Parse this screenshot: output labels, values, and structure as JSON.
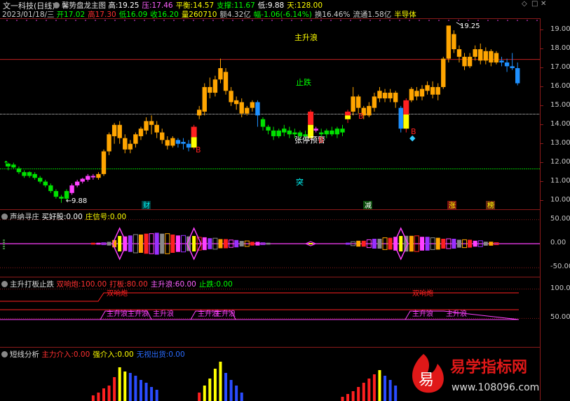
{
  "window": {
    "title": "文一科技(日线)",
    "indicator_name": "馨势盘龙主图",
    "controls": [
      "◇",
      "□",
      "✕"
    ]
  },
  "main_info": {
    "items": [
      {
        "label": "高:",
        "value": "19.25",
        "color": "#ffffff"
      },
      {
        "label": "压:",
        "value": "17.46",
        "color": "#ff60ff"
      },
      {
        "label": "平衡:",
        "value": "14.57",
        "color": "#ffff00"
      },
      {
        "label": "支撑:",
        "value": "11.67",
        "color": "#00ff00"
      },
      {
        "label": "低:",
        "value": "9.88",
        "color": "#ffffff"
      },
      {
        "label": "天:",
        "value": "128.00",
        "color": "#ffff00"
      }
    ]
  },
  "quote_bar": {
    "date": "2023/01/18/三",
    "items": [
      {
        "text": "开17.02",
        "color": "#00ff00"
      },
      {
        "text": "高17.30",
        "color": "#ff3030"
      },
      {
        "text": "低16.09",
        "color": "#00ff00"
      },
      {
        "text": "收16.20",
        "color": "#00ff00"
      },
      {
        "text": "量260710",
        "color": "#ffff00"
      },
      {
        "text": "额4.32亿",
        "color": "#cccccc"
      },
      {
        "text": "幅-1.06(-6.14%)",
        "color": "#00ff00"
      },
      {
        "text": "换16.46%",
        "color": "#cccccc"
      },
      {
        "text": "流通1.58亿",
        "color": "#cccccc"
      },
      {
        "text": "半导体",
        "color": "#ffff00"
      }
    ]
  },
  "main_chart": {
    "ylim": [
      9.5,
      19.6
    ],
    "y_ticks": [
      "19.00",
      "18.00",
      "17.00",
      "16.00",
      "15.00",
      "14.00",
      "13.00",
      "12.00",
      "11.00",
      "10.00"
    ],
    "resistance": 17.46,
    "balance": 14.57,
    "support": 11.67,
    "high_label": "19.25",
    "low_label": "9.88",
    "annotations": {
      "main_wave": "主升浪",
      "stop_fall": "止跌",
      "limit_up_warn": "张停预警",
      "breakout": "突",
      "buy1": "B",
      "buy2": "B",
      "buy3": "B",
      "buy4": "B",
      "arrow_up": "↑",
      "diamond": "◆"
    },
    "bottom_tags": [
      "财",
      "减",
      "涨",
      "榜"
    ]
  },
  "chart_data": {
    "type": "candlestick",
    "ylim": [
      9.5,
      19.6
    ],
    "candles": [
      [
        11.8,
        11.95,
        11.6,
        12.0,
        "g"
      ],
      [
        11.9,
        11.75,
        11.7,
        12.0,
        "g"
      ],
      [
        11.7,
        11.5,
        11.4,
        11.8,
        "g"
      ],
      [
        11.5,
        11.3,
        11.2,
        11.6,
        "g"
      ],
      [
        11.3,
        11.5,
        11.2,
        11.55,
        "g"
      ],
      [
        11.4,
        11.2,
        11.1,
        11.5,
        "g"
      ],
      [
        11.2,
        11.0,
        10.9,
        11.3,
        "g"
      ],
      [
        11.0,
        10.8,
        10.7,
        11.1,
        "g"
      ],
      [
        10.8,
        10.5,
        10.4,
        10.9,
        "g"
      ],
      [
        10.5,
        10.2,
        10.1,
        10.6,
        "g"
      ],
      [
        10.2,
        10.1,
        9.88,
        10.3,
        "g"
      ],
      [
        10.1,
        10.5,
        10.0,
        10.6,
        "g"
      ],
      [
        10.4,
        10.8,
        10.3,
        10.9,
        "m"
      ],
      [
        10.8,
        11.0,
        10.7,
        11.1,
        "m"
      ],
      [
        11.0,
        11.15,
        10.9,
        11.2,
        "m"
      ],
      [
        11.1,
        11.3,
        11.0,
        11.4,
        "m"
      ],
      [
        11.3,
        11.25,
        11.1,
        11.4,
        "m"
      ],
      [
        11.2,
        11.4,
        11.1,
        11.5,
        "o"
      ],
      [
        11.4,
        12.6,
        11.3,
        12.7,
        "o"
      ],
      [
        12.6,
        13.5,
        12.4,
        13.6,
        "o"
      ],
      [
        13.4,
        14.0,
        13.0,
        14.1,
        "o"
      ],
      [
        14.0,
        13.3,
        13.0,
        14.2,
        "o"
      ],
      [
        13.3,
        12.7,
        12.5,
        13.5,
        "o"
      ],
      [
        12.7,
        13.0,
        12.5,
        13.2,
        "o"
      ],
      [
        13.0,
        13.5,
        12.8,
        13.6,
        "o"
      ],
      [
        13.4,
        13.8,
        13.2,
        13.9,
        "o"
      ],
      [
        13.7,
        14.2,
        13.5,
        14.4,
        "o"
      ],
      [
        14.2,
        14.0,
        13.5,
        14.5,
        "o"
      ],
      [
        14.0,
        13.6,
        13.3,
        14.2,
        "o"
      ],
      [
        13.6,
        13.2,
        13.0,
        13.8,
        "o"
      ],
      [
        13.2,
        12.9,
        12.7,
        13.4,
        "o"
      ],
      [
        12.9,
        13.3,
        12.8,
        13.4,
        "o"
      ],
      [
        13.2,
        13.0,
        12.8,
        13.3,
        "b"
      ],
      [
        13.0,
        13.1,
        12.7,
        13.3,
        "b"
      ],
      [
        13.0,
        12.8,
        12.6,
        13.2,
        "b"
      ],
      [
        12.8,
        13.9,
        12.7,
        14.0,
        "r"
      ],
      [
        14.5,
        14.8,
        14.3,
        15.0,
        "o"
      ],
      [
        14.7,
        16.0,
        14.5,
        16.2,
        "o"
      ],
      [
        16.0,
        15.7,
        15.4,
        16.5,
        "o"
      ],
      [
        15.7,
        16.4,
        15.5,
        16.6,
        "o"
      ],
      [
        16.4,
        17.0,
        16.2,
        17.5,
        "o"
      ],
      [
        16.8,
        15.8,
        15.6,
        17.0,
        "o"
      ],
      [
        15.8,
        15.2,
        15.0,
        16.0,
        "o"
      ],
      [
        15.1,
        15.3,
        14.8,
        15.5,
        "o"
      ],
      [
        15.2,
        14.6,
        14.4,
        15.4,
        "o"
      ],
      [
        14.6,
        14.9,
        14.5,
        15.0,
        "o"
      ],
      [
        14.9,
        15.2,
        14.7,
        15.3,
        "o"
      ],
      [
        15.2,
        14.5,
        13.9,
        15.3,
        "b"
      ],
      [
        14.3,
        13.9,
        13.7,
        14.4,
        "g"
      ],
      [
        13.9,
        13.7,
        13.5,
        14.0,
        "g"
      ],
      [
        13.7,
        13.4,
        13.2,
        13.9,
        "g"
      ],
      [
        13.4,
        13.7,
        13.3,
        13.8,
        "g"
      ],
      [
        13.6,
        13.8,
        13.4,
        14.0,
        "g"
      ],
      [
        13.7,
        13.5,
        13.3,
        13.9,
        "g"
      ],
      [
        13.5,
        13.6,
        13.3,
        13.8,
        "g"
      ],
      [
        13.6,
        13.4,
        13.2,
        13.7,
        "g"
      ],
      [
        13.4,
        13.5,
        13.2,
        13.7,
        "g"
      ],
      [
        13.3,
        14.7,
        13.2,
        14.8,
        "r"
      ],
      [
        13.7,
        13.8,
        13.6,
        13.9,
        "m"
      ],
      [
        13.6,
        13.5,
        13.3,
        13.8,
        "g"
      ],
      [
        13.5,
        13.7,
        13.3,
        13.8,
        "g"
      ],
      [
        13.7,
        13.5,
        13.4,
        13.9,
        "g"
      ],
      [
        13.5,
        13.8,
        13.3,
        13.9,
        "g"
      ],
      [
        13.8,
        13.6,
        13.4,
        14.0,
        "g"
      ],
      [
        14.3,
        14.7,
        14.1,
        14.8,
        "r"
      ],
      [
        14.7,
        15.5,
        14.5,
        16.0,
        "o"
      ],
      [
        15.5,
        14.9,
        14.6,
        15.6,
        "o"
      ],
      [
        14.9,
        14.5,
        14.3,
        15.0,
        "o"
      ],
      [
        14.5,
        15.0,
        14.4,
        15.2,
        "o"
      ],
      [
        14.9,
        15.5,
        14.7,
        15.7,
        "o"
      ],
      [
        15.4,
        15.8,
        15.2,
        16.0,
        "o"
      ],
      [
        15.7,
        15.4,
        15.2,
        15.9,
        "o"
      ],
      [
        15.4,
        15.7,
        15.2,
        15.9,
        "o"
      ],
      [
        15.7,
        15.2,
        14.9,
        15.8,
        "o"
      ],
      [
        14.9,
        13.8,
        13.6,
        15.0,
        "b"
      ],
      [
        13.8,
        15.3,
        13.6,
        15.4,
        "r"
      ],
      [
        15.3,
        15.9,
        15.2,
        16.0,
        "o"
      ],
      [
        15.8,
        15.5,
        15.3,
        16.0,
        "o"
      ],
      [
        15.5,
        15.9,
        15.3,
        16.1,
        "o"
      ],
      [
        15.8,
        16.1,
        15.6,
        16.3,
        "o"
      ],
      [
        16.0,
        15.6,
        15.4,
        16.3,
        "o"
      ],
      [
        15.6,
        16.0,
        15.3,
        16.2,
        "o"
      ],
      [
        16.0,
        17.5,
        15.9,
        17.6,
        "o"
      ],
      [
        17.5,
        19.25,
        17.3,
        19.25,
        "o"
      ],
      [
        18.8,
        18.0,
        17.8,
        19.0,
        "o"
      ],
      [
        18.0,
        17.6,
        17.3,
        18.2,
        "o"
      ],
      [
        17.6,
        17.1,
        16.9,
        17.8,
        "o"
      ],
      [
        17.1,
        17.6,
        17.0,
        17.8,
        "o"
      ],
      [
        17.6,
        18.0,
        17.4,
        18.2,
        "o"
      ],
      [
        18.0,
        17.4,
        17.2,
        18.3,
        "o"
      ],
      [
        17.4,
        17.9,
        17.2,
        18.1,
        "o"
      ],
      [
        17.9,
        17.3,
        17.1,
        18.0,
        "o"
      ],
      [
        17.3,
        17.8,
        17.2,
        17.9,
        "o"
      ],
      [
        17.4,
        17.3,
        17.1,
        17.6,
        "b"
      ],
      [
        17.3,
        17.1,
        16.8,
        17.5,
        "b"
      ],
      [
        17.1,
        17.0,
        16.9,
        17.8,
        "b"
      ],
      [
        17.0,
        16.2,
        16.09,
        17.3,
        "b"
      ]
    ]
  },
  "panel2": {
    "title": "声纳寻庄",
    "items": [
      {
        "label": "买好股:",
        "value": "0.00",
        "color": "#ffffff"
      },
      {
        "label": "庄信号:",
        "value": "0.00",
        "color": "#ffff00"
      }
    ],
    "y_ticks": [
      "50.00",
      "0.00",
      "-50.00"
    ],
    "ylim": [
      -70,
      70
    ]
  },
  "panel3": {
    "title": "主升打板止跌",
    "items": [
      {
        "label": "双响炮:",
        "value": "100.00",
        "color": "#ff3030"
      },
      {
        "label": "打板:",
        "value": "80.00",
        "color": "#ff3030"
      },
      {
        "label": "主升浪:",
        "value": "60.00",
        "color": "#ff60ff"
      },
      {
        "label": "止跌:",
        "value": "0.00",
        "color": "#00ff00"
      }
    ],
    "y_ticks": [
      "100.0",
      "50.00"
    ],
    "ylim": [
      0,
      120
    ],
    "labels": {
      "double1": "双响炮",
      "double2": "双响炮",
      "rise_labels": [
        "主升浪",
        "主升浪",
        "主升浪",
        "主升浪",
        "主升浪",
        "主升浪"
      ]
    }
  },
  "panel4": {
    "title": "短线分析",
    "items": [
      {
        "label": "主力介入:",
        "value": "0.00",
        "color": "#ff3030"
      },
      {
        "label": "强介入:",
        "value": "0.00",
        "color": "#ffff00"
      },
      {
        "label": "无视出货:",
        "value": "0.00",
        "color": "#2a6cff"
      }
    ]
  },
  "watermark": {
    "brand": "易学指标网",
    "url": "www.108096.com",
    "glyph": "易"
  },
  "colors": {
    "orange": "#ffa500",
    "red": "#ff2020",
    "green": "#00e000",
    "magenta": "#ff40ff",
    "blue": "#1e90ff",
    "yellow": "#ffff00",
    "grid": "#8b1a1a"
  }
}
